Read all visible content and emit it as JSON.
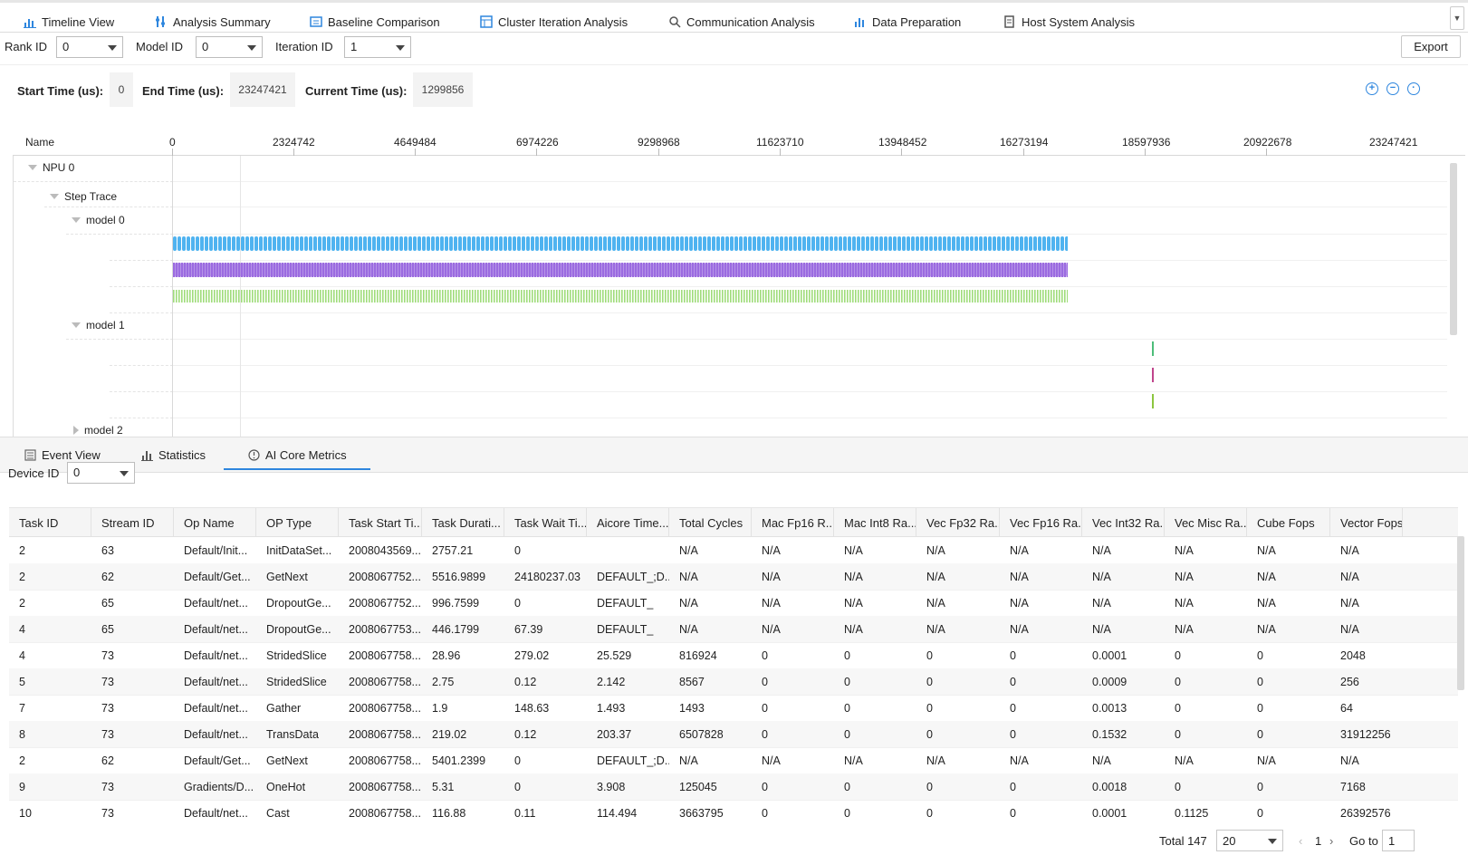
{
  "top_tabs": [
    {
      "label": "Timeline View",
      "icon": "timeline-icon"
    },
    {
      "label": "Analysis Summary",
      "icon": "summary-icon"
    },
    {
      "label": "Baseline Comparison",
      "icon": "baseline-icon"
    },
    {
      "label": "Cluster Iteration Analysis",
      "icon": "cluster-icon"
    },
    {
      "label": "Communication Analysis",
      "icon": "communication-icon"
    },
    {
      "label": "Data Preparation",
      "icon": "data-prep-icon"
    },
    {
      "label": "Host System Analysis",
      "icon": "host-icon"
    }
  ],
  "filters": {
    "rank_label": "Rank ID",
    "rank_value": "0",
    "model_label": "Model ID",
    "model_value": "0",
    "iteration_label": "Iteration ID",
    "iteration_value": "1",
    "export_label": "Export"
  },
  "time_info": {
    "start_label": "Start Time (us):",
    "start_value": "0",
    "end_label": "End Time (us):",
    "end_value": "23247421",
    "current_label": "Current Time (us):",
    "current_value": "1299856"
  },
  "ruler": {
    "name_label": "Name",
    "ticks": [
      "0",
      "2324742",
      "4649484",
      "6974226",
      "9298968",
      "11623710",
      "13948452",
      "16273194",
      "18597936",
      "20922678",
      "23247421"
    ]
  },
  "tree": {
    "npu": "NPU 0",
    "step_trace": "Step Trace",
    "model0": "model 0",
    "model1": "model 1",
    "model2": "model 2"
  },
  "colors": {
    "accent": "#2e86de",
    "bar_blue": "#4fb3f0",
    "bar_purple": "#9b6be0",
    "bar_green": "#9fdc7a",
    "mark_green": "#4dbd7a",
    "mark_pink": "#c0458c",
    "mark_olive": "#8cc63f"
  },
  "bottom_tabs": [
    {
      "label": "Event View",
      "icon": "event-view-icon"
    },
    {
      "label": "Statistics",
      "icon": "statistics-icon"
    },
    {
      "label": "AI Core Metrics",
      "icon": "ai-core-icon"
    }
  ],
  "device": {
    "label": "Device ID",
    "value": "0"
  },
  "table": {
    "columns": [
      "Task ID",
      "Stream ID",
      "Op Name",
      "OP Type",
      "Task Start Ti...",
      "Task Durati...",
      "Task Wait Ti...",
      "Aicore Time...",
      "Total Cycles",
      "Mac Fp16 R...",
      "Mac Int8 Ra...",
      "Vec Fp32 Ra...",
      "Vec Fp16 Ra...",
      "Vec Int32 Ra...",
      "Vec Misc Ra...",
      "Cube Fops",
      "Vector Fops"
    ],
    "rows": [
      [
        "2",
        "63",
        "Default/Init...",
        "InitDataSet...",
        "2008043569...",
        "2757.21",
        "0",
        "",
        "N/A",
        "N/A",
        "N/A",
        "N/A",
        "N/A",
        "N/A",
        "N/A",
        "N/A",
        "N/A"
      ],
      [
        "2",
        "62",
        "Default/Get...",
        "GetNext",
        "2008067752...",
        "5516.9899",
        "24180237.03",
        "DEFAULT_;D...",
        "N/A",
        "N/A",
        "N/A",
        "N/A",
        "N/A",
        "N/A",
        "N/A",
        "N/A",
        "N/A"
      ],
      [
        "2",
        "65",
        "Default/net...",
        "DropoutGe...",
        "2008067752...",
        "996.7599",
        "0",
        "DEFAULT_",
        "N/A",
        "N/A",
        "N/A",
        "N/A",
        "N/A",
        "N/A",
        "N/A",
        "N/A",
        "N/A"
      ],
      [
        "4",
        "65",
        "Default/net...",
        "DropoutGe...",
        "2008067753...",
        "446.1799",
        "67.39",
        "DEFAULT_",
        "N/A",
        "N/A",
        "N/A",
        "N/A",
        "N/A",
        "N/A",
        "N/A",
        "N/A",
        "N/A"
      ],
      [
        "4",
        "73",
        "Default/net...",
        "StridedSlice",
        "2008067758...",
        "28.96",
        "279.02",
        "25.529",
        "816924",
        "0",
        "0",
        "0",
        "0",
        "0.0001",
        "0",
        "0",
        "2048"
      ],
      [
        "5",
        "73",
        "Default/net...",
        "StridedSlice",
        "2008067758...",
        "2.75",
        "0.12",
        "2.142",
        "8567",
        "0",
        "0",
        "0",
        "0",
        "0.0009",
        "0",
        "0",
        "256"
      ],
      [
        "7",
        "73",
        "Default/net...",
        "Gather",
        "2008067758...",
        "1.9",
        "148.63",
        "1.493",
        "1493",
        "0",
        "0",
        "0",
        "0",
        "0.0013",
        "0",
        "0",
        "64"
      ],
      [
        "8",
        "73",
        "Default/net...",
        "TransData",
        "2008067758...",
        "219.02",
        "0.12",
        "203.37",
        "6507828",
        "0",
        "0",
        "0",
        "0",
        "0.1532",
        "0",
        "0",
        "31912256"
      ],
      [
        "2",
        "62",
        "Default/Get...",
        "GetNext",
        "2008067758...",
        "5401.2399",
        "0",
        "DEFAULT_;D...",
        "N/A",
        "N/A",
        "N/A",
        "N/A",
        "N/A",
        "N/A",
        "N/A",
        "N/A",
        "N/A"
      ],
      [
        "9",
        "73",
        "Gradients/D...",
        "OneHot",
        "2008067758...",
        "5.31",
        "0",
        "3.908",
        "125045",
        "0",
        "0",
        "0",
        "0",
        "0.0018",
        "0",
        "0",
        "7168"
      ],
      [
        "10",
        "73",
        "Default/net...",
        "Cast",
        "2008067758...",
        "116.88",
        "0.11",
        "114.494",
        "3663795",
        "0",
        "0",
        "0",
        "0",
        "0.0001",
        "0.1125",
        "0",
        "26392576"
      ]
    ]
  },
  "pagination": {
    "total": "Total 147",
    "page_size": "20",
    "current_page": "1",
    "goto_label": "Go to",
    "goto_value": "1"
  }
}
